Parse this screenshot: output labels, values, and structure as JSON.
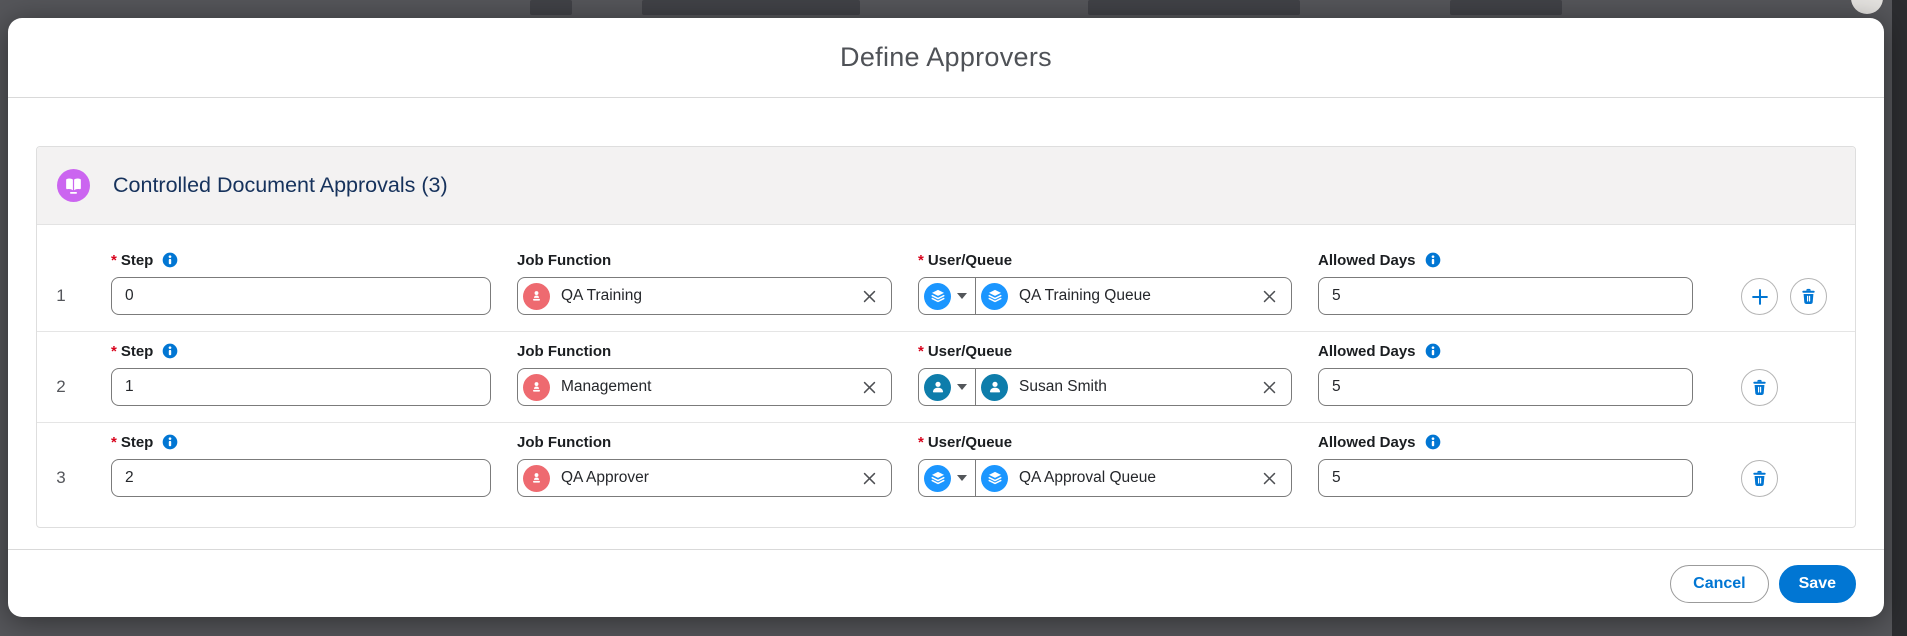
{
  "modal": {
    "title": "Define Approvers",
    "section": {
      "icon": "book-icon",
      "title": "Controlled Document Approvals (3)"
    },
    "columns": {
      "required_marker": "*",
      "step_label": "Step",
      "job_function_label": "Job Function",
      "user_queue_label": "User/Queue",
      "allowed_days_label": "Allowed Days"
    },
    "rows": [
      {
        "index": "1",
        "step": "0",
        "job_function": "QA Training",
        "user_queue": "QA Training Queue",
        "user_queue_type": "queue",
        "allowed_days": "5",
        "can_add": true
      },
      {
        "index": "2",
        "step": "1",
        "job_function": "Management",
        "user_queue": "Susan Smith",
        "user_queue_type": "user",
        "allowed_days": "5",
        "can_add": false
      },
      {
        "index": "3",
        "step": "2",
        "job_function": "QA Approver",
        "user_queue": "QA Approval Queue",
        "user_queue_type": "queue",
        "allowed_days": "5",
        "can_add": false
      }
    ],
    "footer": {
      "cancel_label": "Cancel",
      "save_label": "Save"
    }
  },
  "icons": {
    "section": "book-icon",
    "info": "info-icon",
    "job_function": "person-badge-icon",
    "queue": "layers-icon",
    "user": "user-icon",
    "clear": "close-icon",
    "dropdown": "chevron-down-icon",
    "add": "plus-icon",
    "delete": "trash-icon"
  },
  "colors": {
    "brand": "#0176d3",
    "required": "#d8031c",
    "section_icon_bg": "#cb65f0",
    "job_function_icon_bg": "#ee6a70",
    "queue_icon_bg": "#1b96ff",
    "user_icon_bg": "#0e7dab",
    "section_title_text": "#16325c",
    "backdrop": "#55565a"
  }
}
